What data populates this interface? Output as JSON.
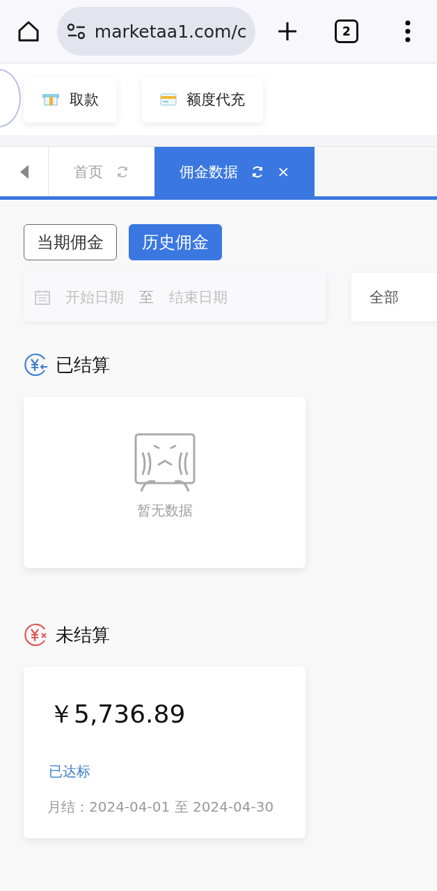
{
  "browser": {
    "url": "marketaa1.com/c",
    "tab_count": "2"
  },
  "shortcuts": [
    {
      "label": "取款",
      "kind": "atm"
    },
    {
      "label": "额度代充",
      "kind": "card"
    }
  ],
  "tabs": [
    {
      "label": "首页",
      "selected": false,
      "closable": false
    },
    {
      "label": "佣金数据",
      "selected": true,
      "closable": true
    }
  ],
  "close_glyph": "×",
  "period_toggle": [
    {
      "label": "当期佣金",
      "selected": false
    },
    {
      "label": "历史佣金",
      "selected": true
    }
  ],
  "filter": {
    "start_placeholder": "开始日期",
    "separator": "至",
    "end_placeholder": "结束日期",
    "status_value": "全部"
  },
  "sections": [
    {
      "kind": "settled",
      "title": "已结算",
      "empty_text": "暂无数据"
    },
    {
      "kind": "unsettled",
      "title": "未结算",
      "amount": "￥5,736.89",
      "status": "已达标",
      "period": "月结：2024-04-01 至 2024-04-30"
    }
  ]
}
